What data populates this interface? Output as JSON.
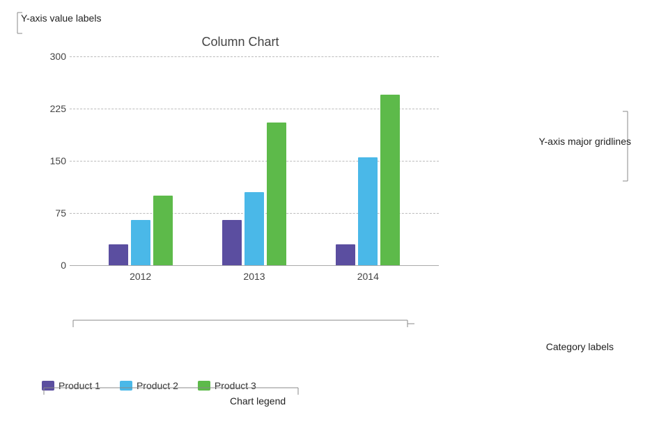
{
  "chart": {
    "title": "Column Chart",
    "yAxis": {
      "labels": [
        "0",
        "75",
        "150",
        "225",
        "300"
      ],
      "values": [
        0,
        75,
        150,
        225,
        300
      ],
      "max": 300,
      "annotationLabel": "Y-axis value labels",
      "gridlinesAnnotation": "Y-axis major gridlines"
    },
    "categories": [
      "2012",
      "2013",
      "2014"
    ],
    "categoryAnnotation": "Category labels",
    "series": [
      {
        "name": "Product 1",
        "color": "#5b4ea0",
        "values": [
          30,
          65,
          30
        ]
      },
      {
        "name": "Product 2",
        "color": "#4ab8e8",
        "values": [
          65,
          105,
          155
        ]
      },
      {
        "name": "Product 3",
        "color": "#5dba4a",
        "values": [
          100,
          205,
          245
        ]
      }
    ],
    "legend": {
      "annotation": "Chart legend",
      "items": [
        "Product 1",
        "Product 2",
        "Product 3"
      ]
    }
  }
}
